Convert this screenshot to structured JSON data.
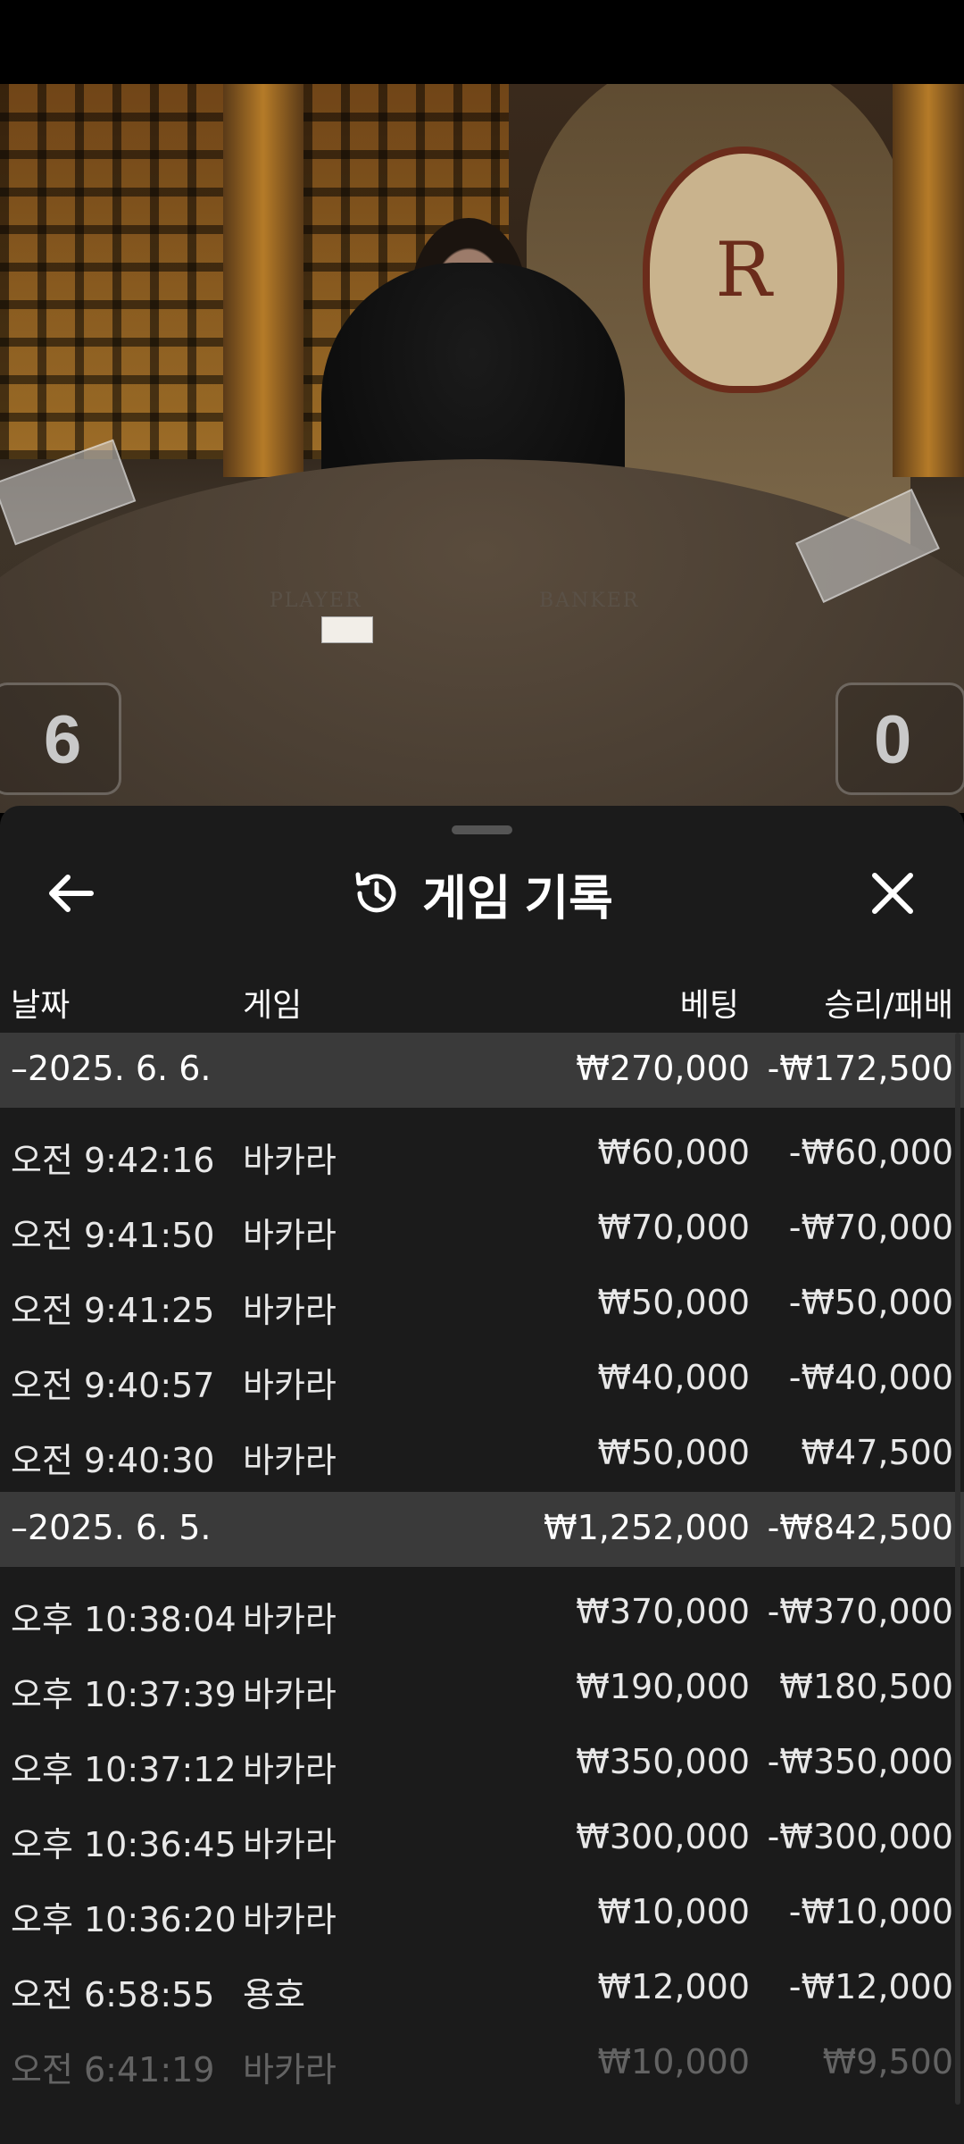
{
  "video": {
    "player_label": "PLAYER",
    "banker_label": "BANKER",
    "crest_letter": "R",
    "player_score": "6",
    "banker_score": "0"
  },
  "panel": {
    "title": "게임 기록",
    "icons": {
      "back": "arrow-left-icon",
      "history": "history-icon",
      "close": "close-icon"
    },
    "columns": {
      "date": "날짜",
      "game": "게임",
      "bet": "베팅",
      "win_loss": "승리/패배"
    },
    "groups": [
      {
        "date": "–2025. 6. 6.",
        "bet": "₩270,000",
        "win_loss": "-₩172,500",
        "rows": [
          {
            "time": "오전 9:42:16",
            "game": "바카라",
            "bet": "₩60,000",
            "win_loss": "-₩60,000"
          },
          {
            "time": "오전 9:41:50",
            "game": "바카라",
            "bet": "₩70,000",
            "win_loss": "-₩70,000"
          },
          {
            "time": "오전 9:41:25",
            "game": "바카라",
            "bet": "₩50,000",
            "win_loss": "-₩50,000"
          },
          {
            "time": "오전 9:40:57",
            "game": "바카라",
            "bet": "₩40,000",
            "win_loss": "-₩40,000"
          },
          {
            "time": "오전 9:40:30",
            "game": "바카라",
            "bet": "₩50,000",
            "win_loss": "₩47,500"
          }
        ]
      },
      {
        "date": "–2025. 6. 5.",
        "bet": "₩1,252,000",
        "win_loss": "-₩842,500",
        "rows": [
          {
            "time": "오후 10:38:04",
            "game": "바카라",
            "bet": "₩370,000",
            "win_loss": "-₩370,000"
          },
          {
            "time": "오후 10:37:39",
            "game": "바카라",
            "bet": "₩190,000",
            "win_loss": "₩180,500"
          },
          {
            "time": "오후 10:37:12",
            "game": "바카라",
            "bet": "₩350,000",
            "win_loss": "-₩350,000"
          },
          {
            "time": "오후 10:36:45",
            "game": "바카라",
            "bet": "₩300,000",
            "win_loss": "-₩300,000"
          },
          {
            "time": "오후 10:36:20",
            "game": "바카라",
            "bet": "₩10,000",
            "win_loss": "-₩10,000"
          },
          {
            "time": "오전 6:58:55",
            "game": "용호",
            "bet": "₩12,000",
            "win_loss": "-₩12,000"
          },
          {
            "time": "오전 6:41:19",
            "game": "바카라",
            "bet": "₩10,000",
            "win_loss": "₩9,500"
          }
        ]
      }
    ]
  }
}
